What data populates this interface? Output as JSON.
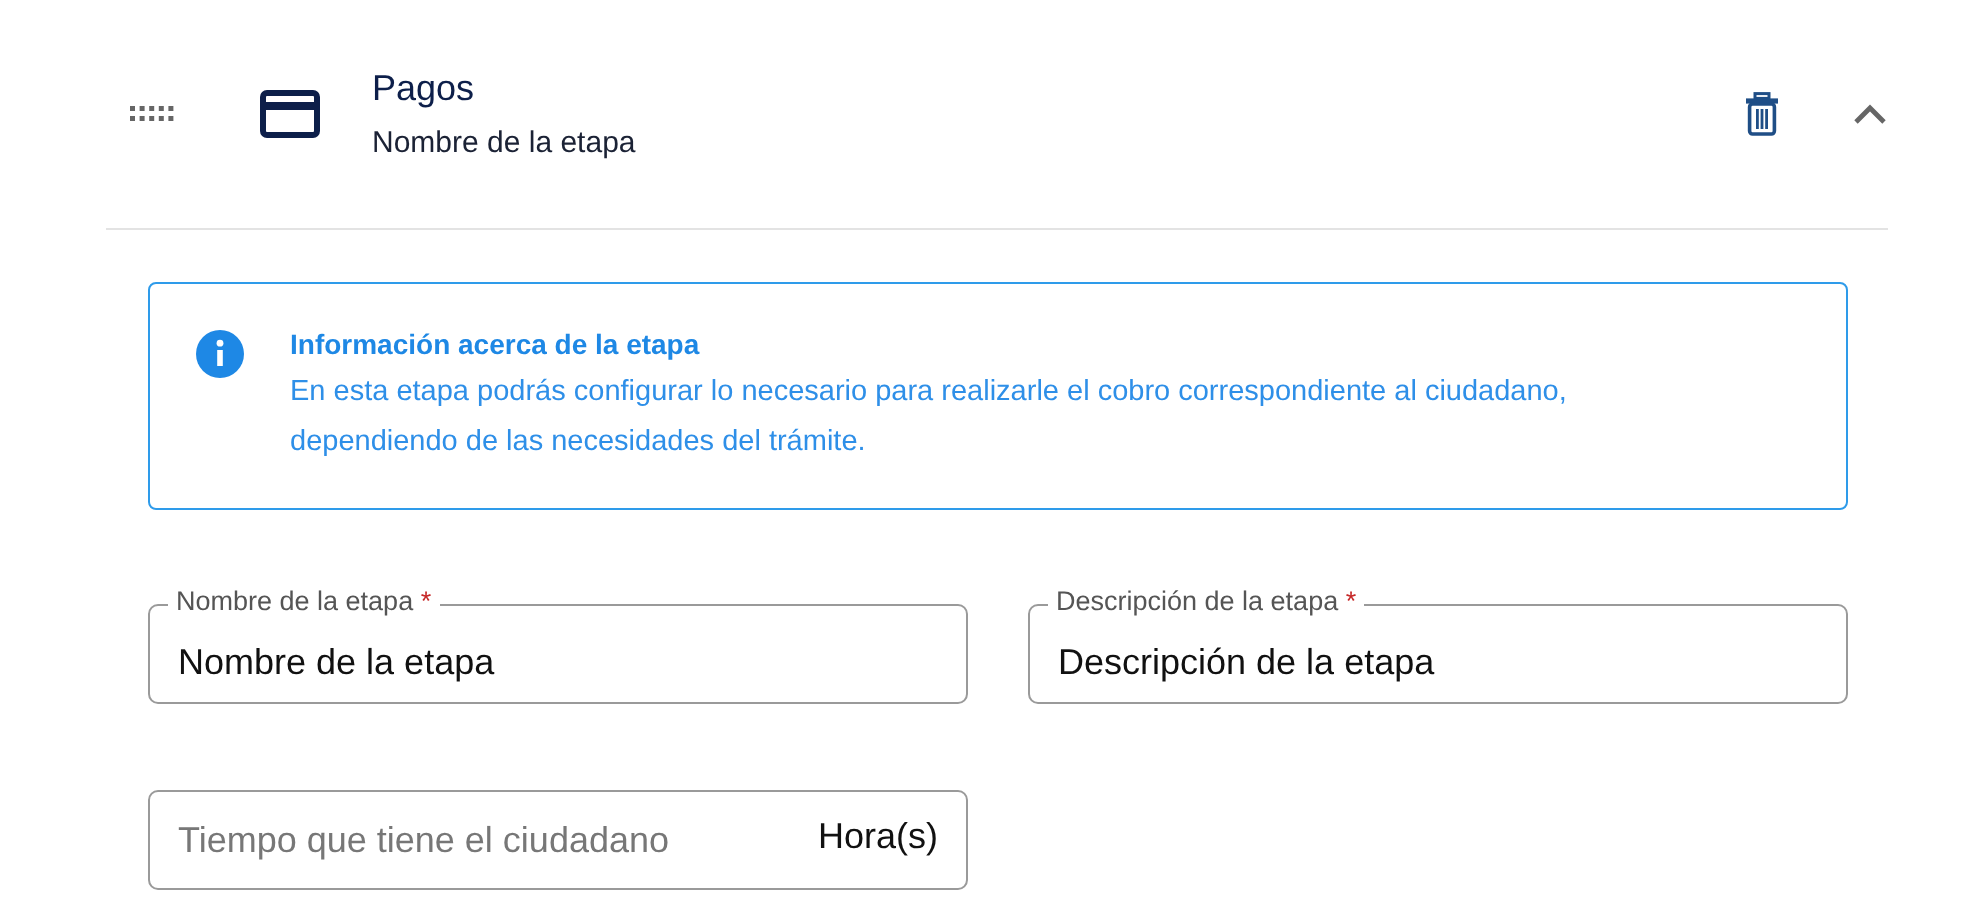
{
  "step": {
    "title": "Pagos",
    "subtitle": "Nombre de la etapa",
    "expanded": true
  },
  "info": {
    "title": "Información acerca de la etapa",
    "text": "En esta etapa podrás configurar lo necesario para realizarle el cobro correspondiente al ciudadano, dependiendo de las necesidades del trámite."
  },
  "fields": [
    {
      "label": "Nombre de la etapa",
      "required_mark": "*",
      "value": "Nombre de la etapa"
    },
    {
      "label": "Descripción de la etapa",
      "required_mark": "*",
      "value": "Descripción de la etapa"
    },
    {
      "placeholder": "Tiempo que tiene el ciudadano",
      "suffix": "Hora(s)"
    }
  ]
}
